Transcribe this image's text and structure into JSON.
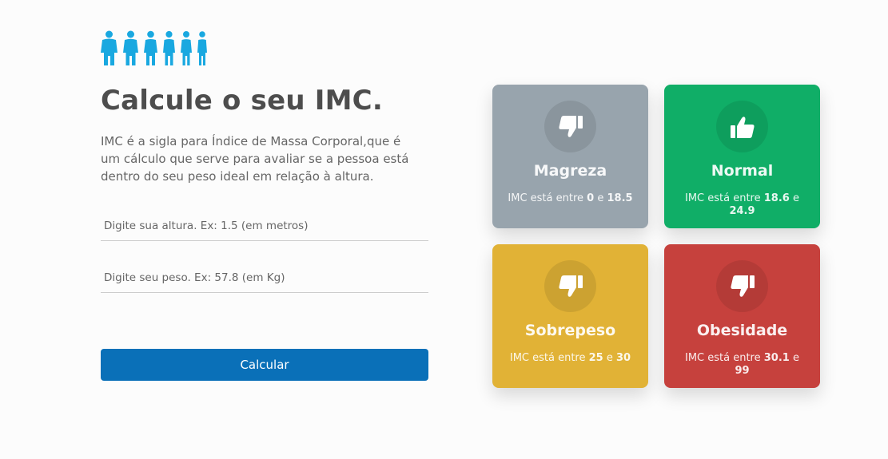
{
  "header": {
    "people_icon": "people-silhouettes-icon",
    "people_color": "#19a8e0",
    "title": "Calcule o seu IMC.",
    "description": "IMC é a sigla para Índice de Massa Corporal,que é um cálculo que serve para avaliar se a pessoa está dentro do seu peso ideal em relação à altura."
  },
  "form": {
    "height_placeholder": "Digite sua altura. Ex: 1.5 (em metros)",
    "height_value": "",
    "weight_placeholder": "Digite seu peso. Ex: 57.8 (em Kg)",
    "weight_value": "",
    "calculate_label": "Calcular",
    "button_color": "#0a70b8"
  },
  "cards": [
    {
      "title": "Magreza",
      "range_prefix": "IMC está entre",
      "min": "0",
      "joiner": "e",
      "max": "18.5",
      "color": "#98a4ad",
      "icon": "thumbs-down-icon"
    },
    {
      "title": "Normal",
      "range_prefix": "IMC está entre",
      "min": "18.6",
      "joiner": "e",
      "max": "24.9",
      "color": "#10ae67",
      "icon": "thumbs-up-icon"
    },
    {
      "title": "Sobrepeso",
      "range_prefix": "IMC está entre",
      "min": "25",
      "joiner": "e",
      "max": "30",
      "color": "#e1b236",
      "icon": "thumbs-down-icon"
    },
    {
      "title": "Obesidade",
      "range_prefix": "IMC está entre",
      "min": "30.1",
      "joiner": "e",
      "max": "99",
      "color": "#c6413d",
      "icon": "thumbs-down-icon"
    }
  ]
}
